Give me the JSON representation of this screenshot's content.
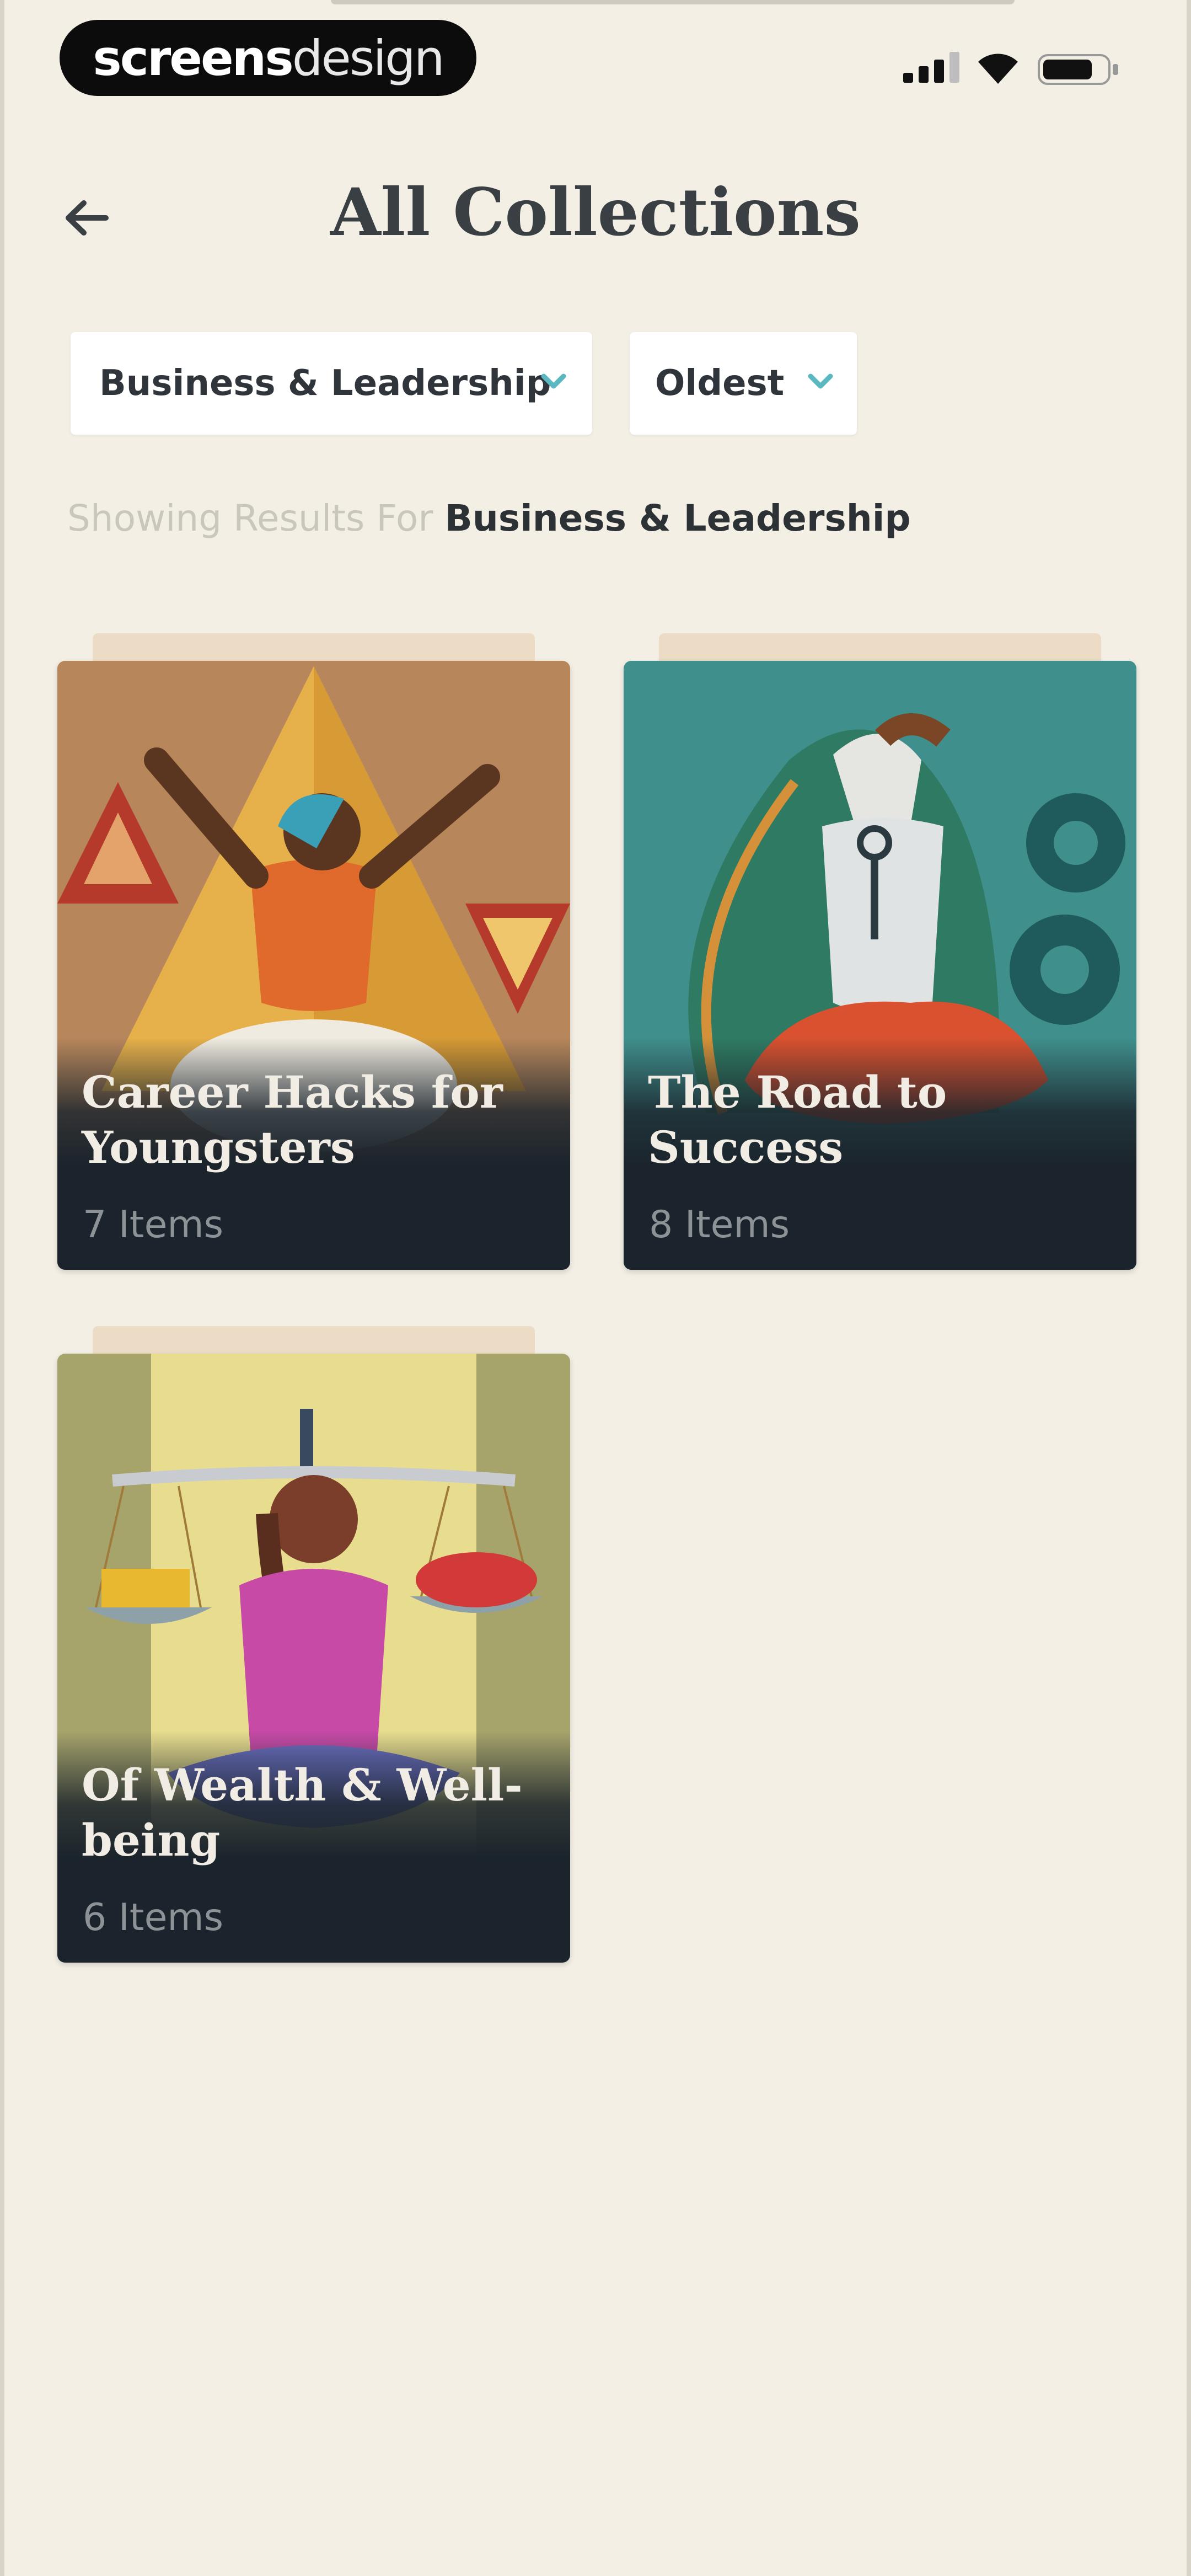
{
  "status_bar": {
    "brand_bold": "screens",
    "brand_light": "design",
    "icons": [
      "signal-icon",
      "wifi-icon",
      "battery-icon"
    ]
  },
  "header": {
    "back_icon": "arrow-left-icon",
    "title": "All Collections"
  },
  "filters": {
    "category": {
      "value": "Business & Leadership",
      "icon": "chevron-down-icon"
    },
    "sort": {
      "value": "Oldest",
      "icon": "chevron-down-icon"
    },
    "accent_color": "#5bb8c0"
  },
  "results": {
    "prefix": "Showing Results For",
    "query": "Business & Leadership"
  },
  "collections": [
    {
      "title": "Career Hacks for Youngsters",
      "count": "7 Items",
      "art": "meditating-figure-pyramid"
    },
    {
      "title": "The Road to Success",
      "count": "8 Items",
      "art": "meditating-figure-key-gears"
    },
    {
      "title": "Of Wealth & Well-being",
      "count": "6 Items",
      "art": "meditating-figure-scales"
    }
  ],
  "colors": {
    "background": "#f3efe5",
    "card_footer": "#1b242c",
    "title_text": "#3a3f44"
  }
}
